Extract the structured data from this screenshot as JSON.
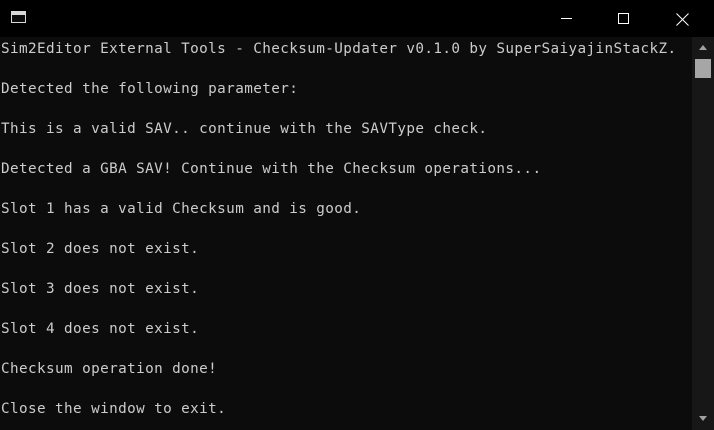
{
  "window": {
    "controls": {
      "minimize": "minimize",
      "maximize": "maximize",
      "close": "close"
    }
  },
  "console": {
    "lines": [
      "Sim2Editor External Tools - Checksum-Updater v0.1.0 by SuperSaiyajinStackZ.",
      "Detected the following parameter:",
      "This is a valid SAV.. continue with the SAVType check.",
      "Detected a GBA SAV! Continue with the Checksum operations...",
      "Slot 1 has a valid Checksum and is good.",
      "Slot 2 does not exist.",
      "Slot 3 does not exist.",
      "Slot 4 does not exist.",
      "Checksum operation done!",
      "Close the window to exit."
    ]
  },
  "colors": {
    "background": "#0c0c0c",
    "text": "#cccccc",
    "titlebar": "#000000"
  },
  "icons": {
    "app": "console-app-icon",
    "minimize": "minimize-icon",
    "maximize": "maximize-icon",
    "close": "close-icon"
  }
}
